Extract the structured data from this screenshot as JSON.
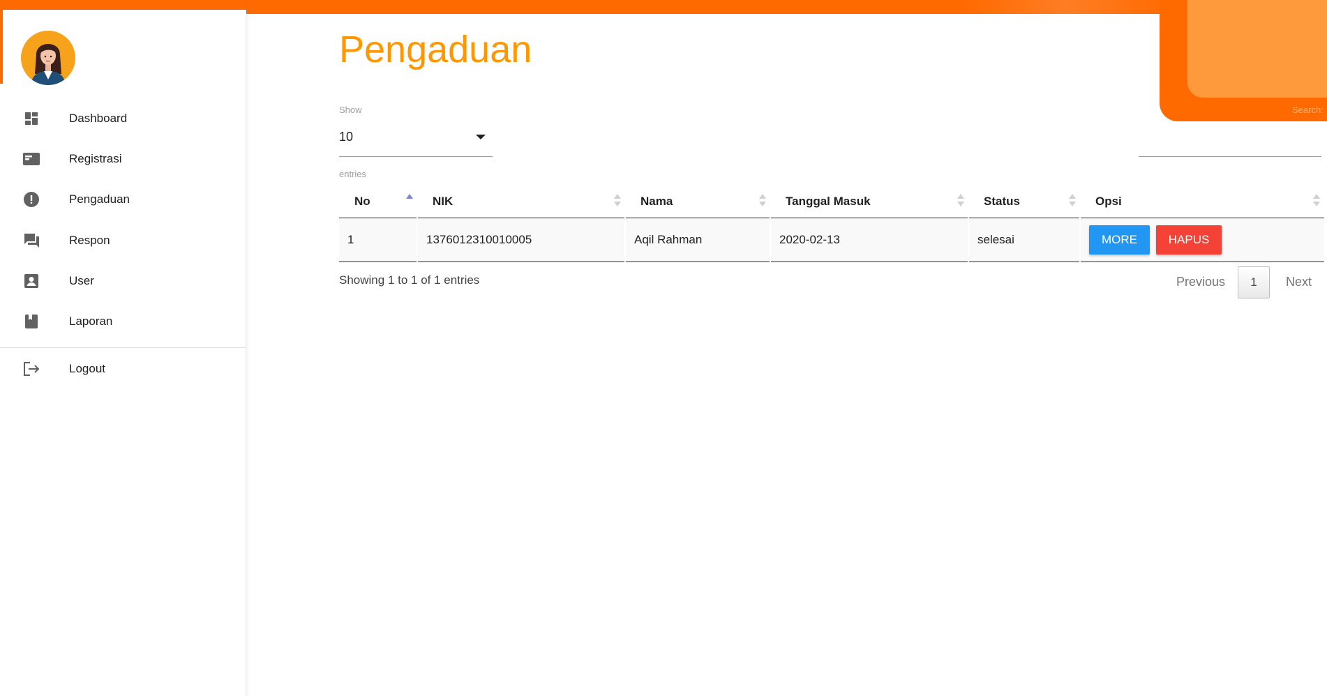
{
  "sidebar": {
    "items": [
      {
        "label": "Dashboard",
        "icon": "dashboard-icon"
      },
      {
        "label": "Registrasi",
        "icon": "card-icon"
      },
      {
        "label": "Pengaduan",
        "icon": "alert-icon"
      },
      {
        "label": "Respon",
        "icon": "chat-icon"
      },
      {
        "label": "User",
        "icon": "account-box-icon"
      },
      {
        "label": "Laporan",
        "icon": "book-icon"
      }
    ],
    "logout": {
      "label": "Logout",
      "icon": "logout-icon"
    }
  },
  "main": {
    "title": "Pengaduan",
    "length": {
      "show_label": "Show",
      "value": "10",
      "entries_label": "entries"
    },
    "search": {
      "label": "Search:",
      "value": ""
    },
    "table": {
      "columns": [
        "No",
        "NIK",
        "Nama",
        "Tanggal Masuk",
        "Status",
        "Opsi"
      ],
      "rows": [
        {
          "no": "1",
          "nik": "1376012310010005",
          "nama": "Aqil Rahman",
          "tanggal": "2020-02-13",
          "status": "selesai"
        }
      ],
      "buttons": {
        "more": "MORE",
        "hapus": "HAPUS"
      }
    },
    "info": "Showing 1 to 1 of 1 entries",
    "pagination": {
      "previous": "Previous",
      "current": "1",
      "next": "Next"
    }
  },
  "colors": {
    "accent": "#ff6a00",
    "title": "#ff9800",
    "more": "#2196f3",
    "hapus": "#f44336"
  }
}
